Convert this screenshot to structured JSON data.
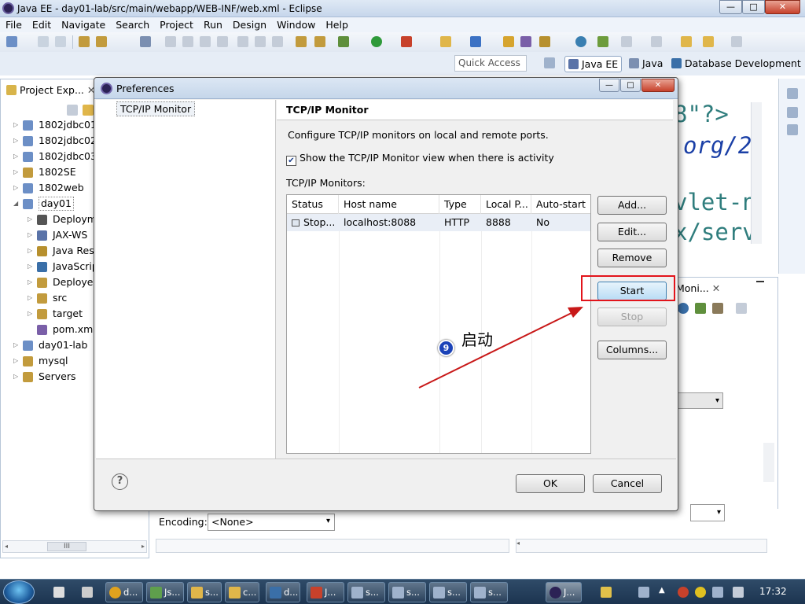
{
  "window": {
    "title": "Java EE - day01-lab/src/main/webapp/WEB-INF/web.xml - Eclipse",
    "min": "—",
    "max": "□",
    "close": "✕"
  },
  "menu": [
    "File",
    "Edit",
    "Navigate",
    "Search",
    "Project",
    "Run",
    "Design",
    "Window",
    "Help"
  ],
  "quick_access": {
    "placeholder": "Quick Access"
  },
  "perspectives": [
    "Java EE",
    "Java",
    "Database Development"
  ],
  "project_explorer": {
    "tab": "Project Exp...",
    "items": [
      {
        "label": "1802jdbc01_",
        "level": 0,
        "arrow": "▷"
      },
      {
        "label": "1802jdbc02_",
        "level": 0,
        "arrow": "▷"
      },
      {
        "label": "1802jdbc03_",
        "level": 0,
        "arrow": "▷"
      },
      {
        "label": "1802SE",
        "level": 0,
        "arrow": "▷"
      },
      {
        "label": "1802web",
        "level": 0,
        "arrow": "▷"
      },
      {
        "label": "day01",
        "level": 0,
        "arrow": "◢"
      },
      {
        "label": "Deploym",
        "level": 1,
        "arrow": "▷"
      },
      {
        "label": "JAX-WS",
        "level": 1,
        "arrow": "▷"
      },
      {
        "label": "Java Res",
        "level": 1,
        "arrow": "▷"
      },
      {
        "label": "JavaScrip",
        "level": 1,
        "arrow": "▷"
      },
      {
        "label": "Deployed",
        "level": 1,
        "arrow": "▷"
      },
      {
        "label": "src",
        "level": 1,
        "arrow": "▷"
      },
      {
        "label": "target",
        "level": 1,
        "arrow": "▷"
      },
      {
        "label": "pom.xml",
        "level": 1,
        "arrow": ""
      },
      {
        "label": "day01-lab",
        "level": 0,
        "arrow": "▷"
      },
      {
        "label": "mysql",
        "level": 0,
        "arrow": "▷"
      },
      {
        "label": "Servers",
        "level": 0,
        "arrow": "▷"
      }
    ],
    "scroll_thumb": "III"
  },
  "editor": {
    "lines": [
      "8\"?>",
      "org/2",
      "vlet-n",
      "x/serv"
    ]
  },
  "bottom_panel": {
    "tab": "Moni...",
    "encoding_label": "Encoding:",
    "encoding_value": "<None>"
  },
  "dialog": {
    "title": "Preferences",
    "nav_item": "TCP/IP Monitor",
    "heading": "TCP/IP Monitor",
    "description": "Configure TCP/IP monitors on local and remote ports.",
    "show_view_checkbox": "Show the TCP/IP Monitor view when there is activity",
    "monitors_label": "TCP/IP Monitors:",
    "columns": [
      "Status",
      "Host name",
      "Type",
      "Local P...",
      "Auto-start"
    ],
    "rows": [
      {
        "status": "Stop...",
        "host": "localhost:8088",
        "type": "HTTP",
        "port": "8888",
        "auto": "No"
      }
    ],
    "buttons": {
      "add": "Add...",
      "edit": "Edit...",
      "remove": "Remove",
      "start": "Start",
      "stop": "Stop",
      "columns": "Columns..."
    },
    "ok": "OK",
    "cancel": "Cancel",
    "help": "?"
  },
  "annotation": {
    "badge": "9",
    "text": "启动"
  },
  "taskbar": {
    "items": [
      "d...",
      "Js...",
      "s...",
      "c...",
      "d...",
      "J...",
      "s...",
      "s...",
      "s...",
      "s...",
      "J..."
    ],
    "clock": "17:32"
  },
  "colors": {
    "accent": "#3c7fb1",
    "annotation_red": "#e2141b",
    "badge_blue": "#1c43b8",
    "code_teal": "#2f7d7d",
    "code_blue": "#1a3fa6"
  }
}
